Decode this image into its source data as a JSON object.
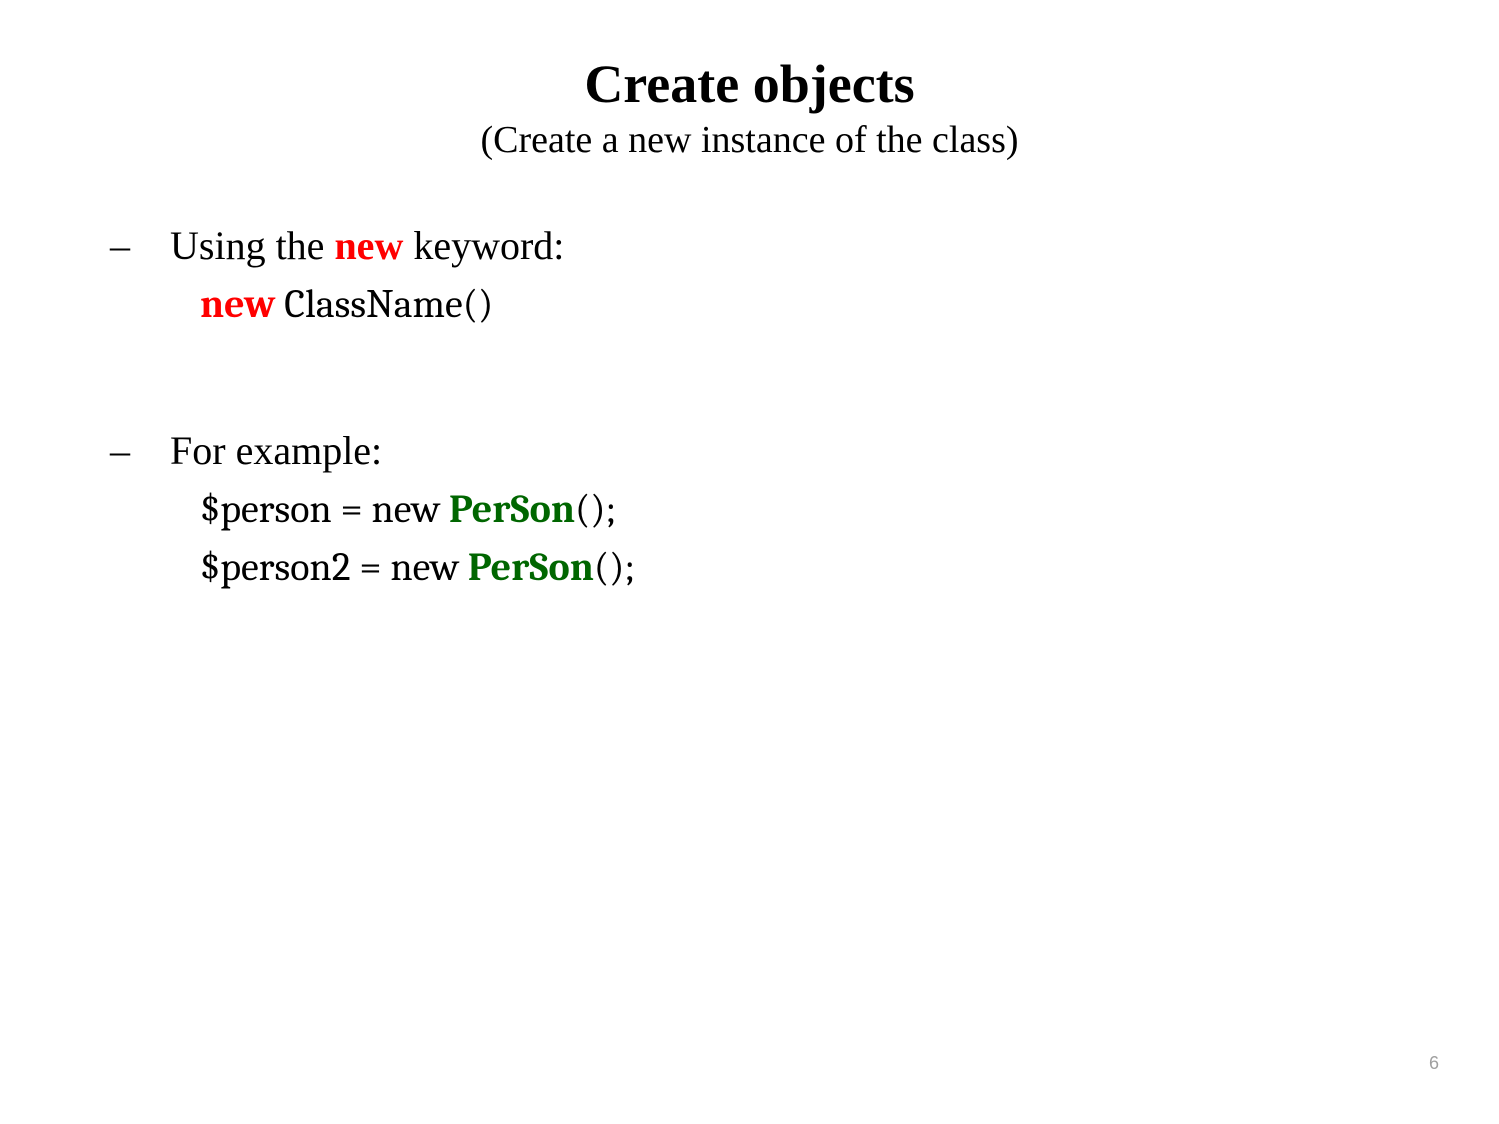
{
  "title": "Create objects",
  "subtitle": "(Create a new instance of the class)",
  "bullet1": {
    "dash": "–",
    "pre": "Using the ",
    "kw": "new",
    "post": " keyword:"
  },
  "code1": {
    "kw": "new",
    "rest": " ClassName()"
  },
  "bullet2": {
    "dash": "–",
    "text": "For example:"
  },
  "code2": {
    "pre": "$person = new ",
    "cls": "PerSon",
    "post": "();"
  },
  "code3": {
    "pre": "$person2 = new ",
    "cls": "PerSon",
    "post": "();"
  },
  "pageNumber": "6"
}
